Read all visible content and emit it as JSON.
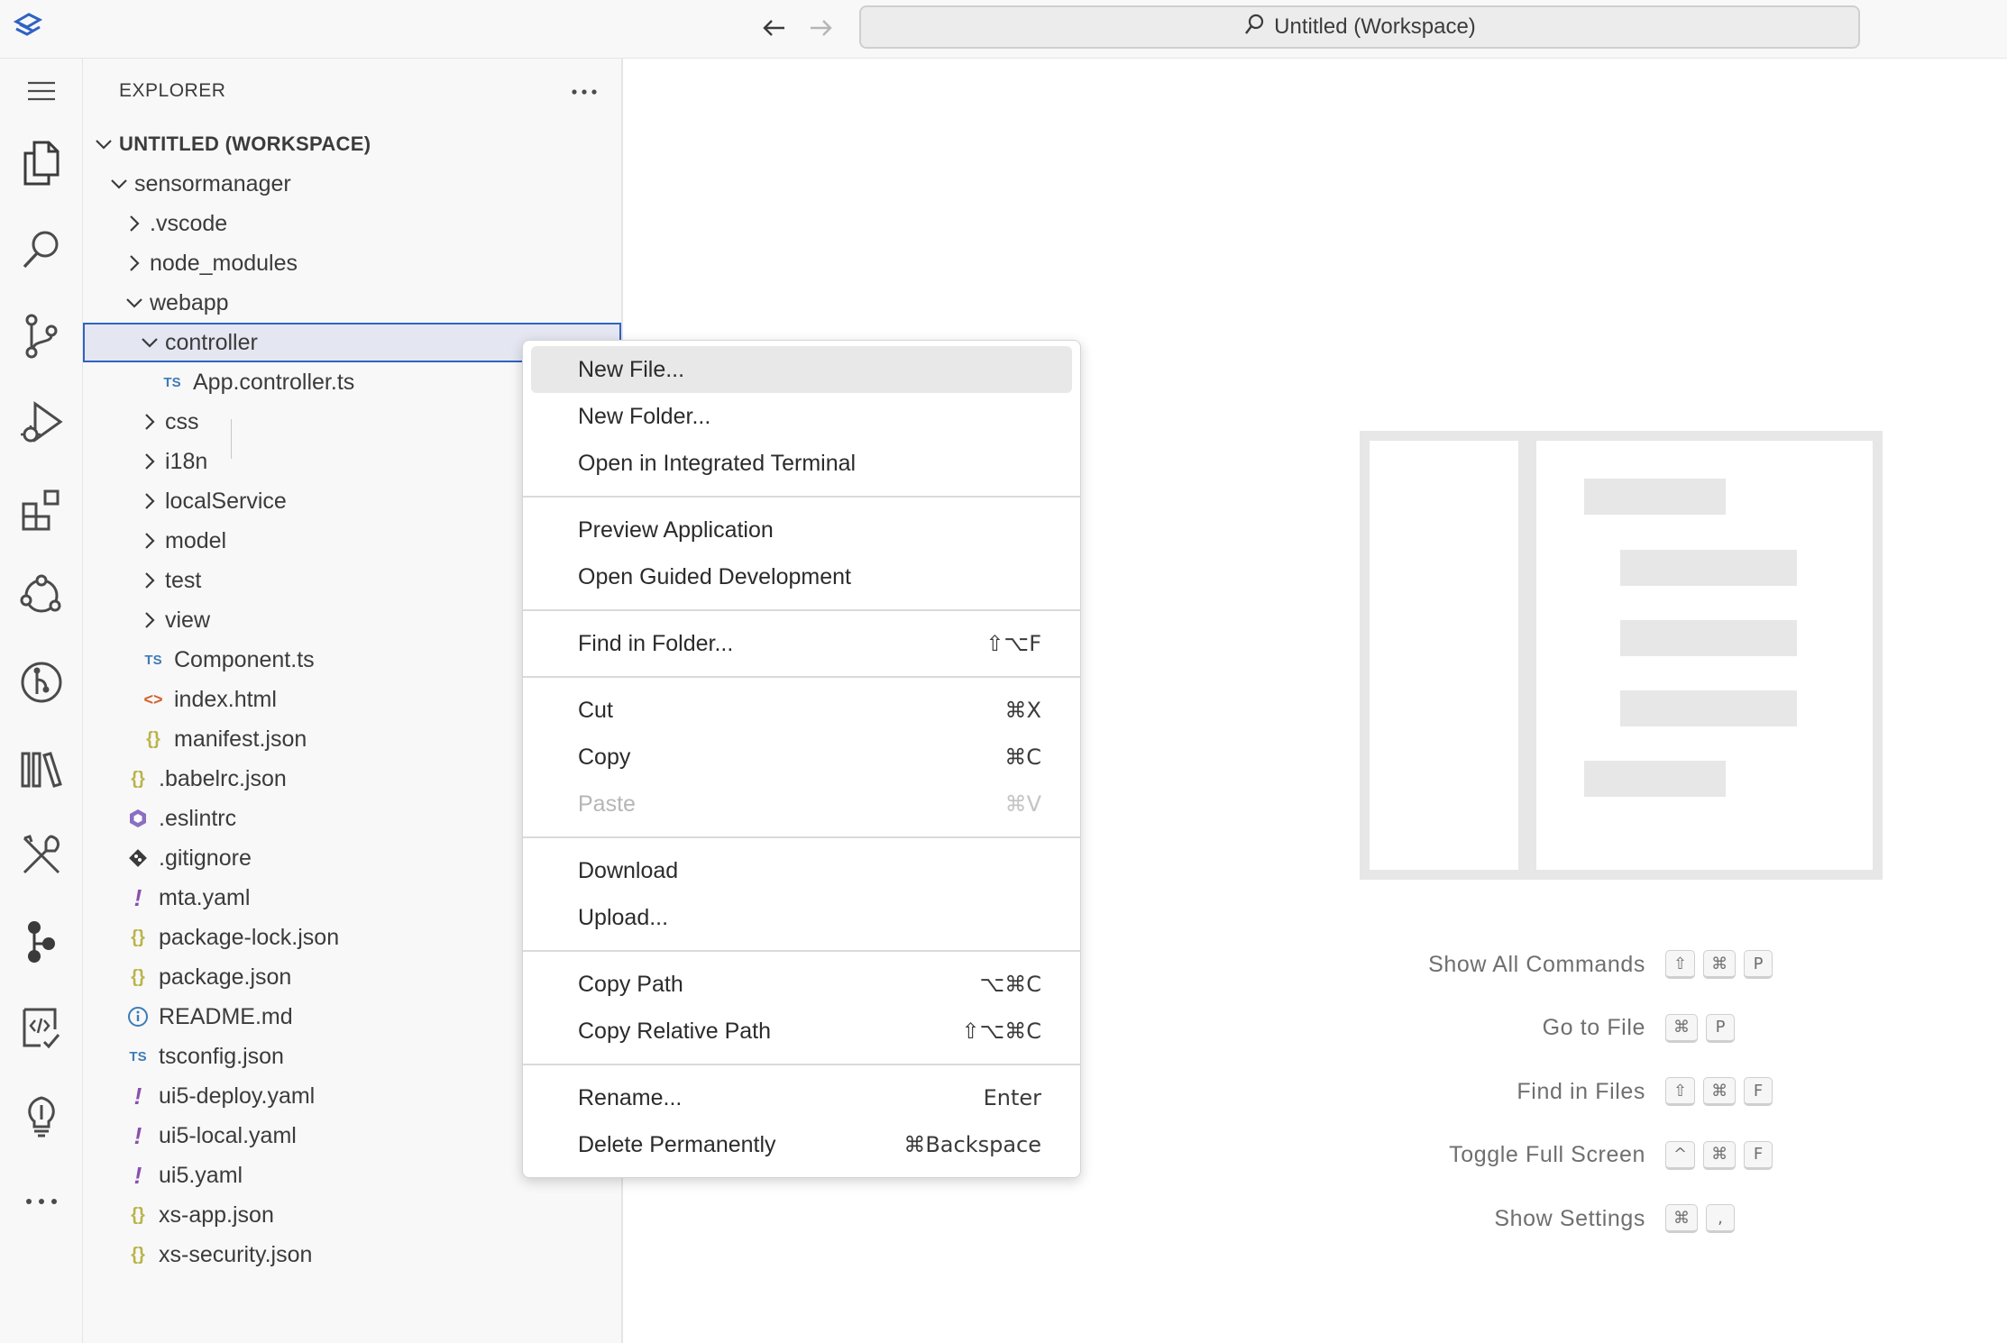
{
  "titlebar": {
    "command_center": "Untitled (Workspace)"
  },
  "sidebar": {
    "title": "EXPLORER",
    "workspace": "UNTITLED (WORKSPACE)",
    "tree": [
      {
        "label": "sensormanager",
        "kind": "folder-open",
        "icon": ""
      },
      {
        "label": ".vscode",
        "kind": "folder",
        "icon": ""
      },
      {
        "label": "node_modules",
        "kind": "folder",
        "icon": ""
      },
      {
        "label": "webapp",
        "kind": "folder-open",
        "icon": ""
      },
      {
        "label": "controller",
        "kind": "folder-open",
        "icon": ""
      },
      {
        "label": "App.controller.ts",
        "kind": "file",
        "icon": "TS"
      },
      {
        "label": "css",
        "kind": "folder",
        "icon": ""
      },
      {
        "label": "i18n",
        "kind": "folder",
        "icon": ""
      },
      {
        "label": "localService",
        "kind": "folder",
        "icon": ""
      },
      {
        "label": "model",
        "kind": "folder",
        "icon": ""
      },
      {
        "label": "test",
        "kind": "folder",
        "icon": ""
      },
      {
        "label": "view",
        "kind": "folder",
        "icon": ""
      },
      {
        "label": "Component.ts",
        "kind": "file",
        "icon": "TS"
      },
      {
        "label": "index.html",
        "kind": "file",
        "icon": "<>"
      },
      {
        "label": "manifest.json",
        "kind": "file",
        "icon": "{}"
      },
      {
        "label": ".babelrc.json",
        "kind": "file",
        "icon": "{}"
      },
      {
        "label": ".eslintrc",
        "kind": "file",
        "icon": "eslint"
      },
      {
        "label": ".gitignore",
        "kind": "file",
        "icon": "git"
      },
      {
        "label": "mta.yaml",
        "kind": "file",
        "icon": "!"
      },
      {
        "label": "package-lock.json",
        "kind": "file",
        "icon": "{}"
      },
      {
        "label": "package.json",
        "kind": "file",
        "icon": "{}"
      },
      {
        "label": "README.md",
        "kind": "file",
        "icon": "info"
      },
      {
        "label": "tsconfig.json",
        "kind": "file",
        "icon": "TS"
      },
      {
        "label": "ui5-deploy.yaml",
        "kind": "file",
        "icon": "!"
      },
      {
        "label": "ui5-local.yaml",
        "kind": "file",
        "icon": "!"
      },
      {
        "label": "ui5.yaml",
        "kind": "file",
        "icon": "!"
      },
      {
        "label": "xs-app.json",
        "kind": "file",
        "icon": "{}"
      },
      {
        "label": "xs-security.json",
        "kind": "file",
        "icon": "{}"
      }
    ]
  },
  "context_menu": {
    "groups": [
      [
        {
          "label": "New File...",
          "key": ""
        },
        {
          "label": "New Folder...",
          "key": ""
        },
        {
          "label": "Open in Integrated Terminal",
          "key": ""
        }
      ],
      [
        {
          "label": "Preview Application",
          "key": ""
        },
        {
          "label": "Open Guided Development",
          "key": ""
        }
      ],
      [
        {
          "label": "Find in Folder...",
          "key": "⇧⌥F"
        }
      ],
      [
        {
          "label": "Cut",
          "key": "⌘X"
        },
        {
          "label": "Copy",
          "key": "⌘C"
        },
        {
          "label": "Paste",
          "key": "⌘V"
        }
      ],
      [
        {
          "label": "Download",
          "key": ""
        },
        {
          "label": "Upload...",
          "key": ""
        }
      ],
      [
        {
          "label": "Copy Path",
          "key": "⌥⌘C"
        },
        {
          "label": "Copy Relative Path",
          "key": "⇧⌥⌘C"
        }
      ],
      [
        {
          "label": "Rename...",
          "key": "Enter"
        },
        {
          "label": "Delete Permanently",
          "key": "⌘Backspace"
        }
      ]
    ]
  },
  "shortcuts": [
    {
      "label": "Show All Commands",
      "keys": [
        "⇧",
        "⌘",
        "P"
      ]
    },
    {
      "label": "Go to File",
      "keys": [
        "⌘",
        "P"
      ]
    },
    {
      "label": "Find in Files",
      "keys": [
        "⇧",
        "⌘",
        "F"
      ]
    },
    {
      "label": "Toggle Full Screen",
      "keys": [
        "^",
        "⌘",
        "F"
      ]
    },
    {
      "label": "Show Settings",
      "keys": [
        "⌘",
        ","
      ]
    }
  ],
  "colors": {
    "accent": "#2f63c2",
    "ts_icon": "#3d7bb6",
    "json_icon": "#b9b44a",
    "yaml_icon": "#8a4fb0",
    "html_icon": "#d3612f"
  }
}
